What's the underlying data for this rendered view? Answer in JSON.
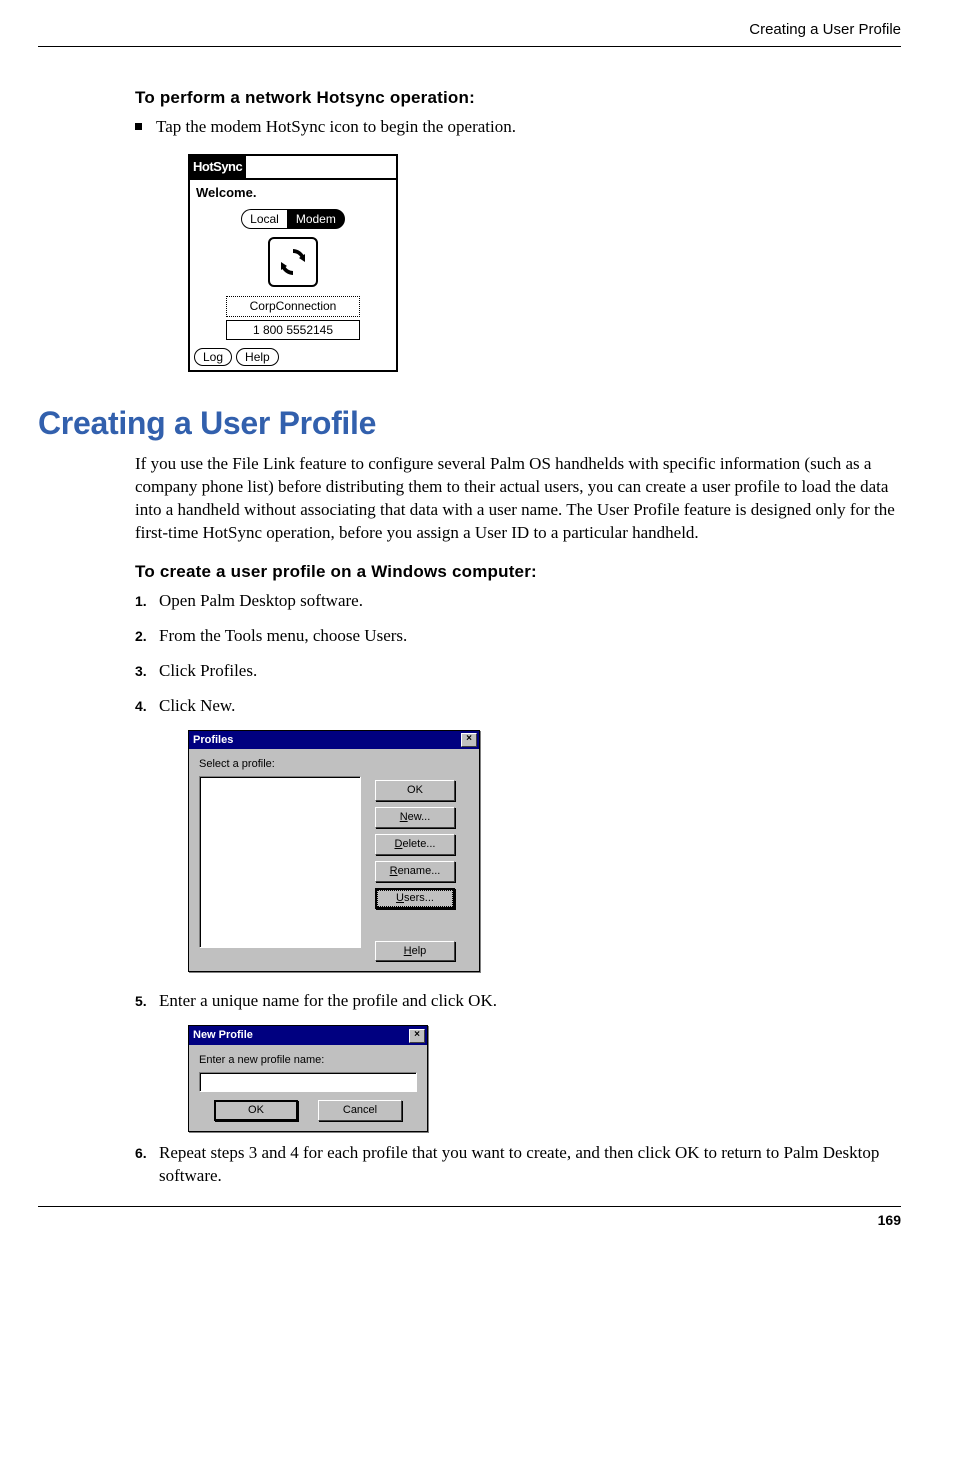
{
  "header": {
    "running": "Creating a User Profile"
  },
  "section1": {
    "subhead": "To perform a network Hotsync operation:",
    "bullet": "Tap the modem HotSync icon to begin the operation."
  },
  "hotsync": {
    "app": "HotSync",
    "welcome": "Welcome.",
    "tab_local": "Local",
    "tab_modem": "Modem",
    "conn": "CorpConnection",
    "phone": "1 800 5552145",
    "log": "Log",
    "help": "Help"
  },
  "section2": {
    "title": "Creating a User Profile",
    "body": "If you use the File Link feature to configure several Palm OS handhelds with specific information (such as a company phone list) before distributing them to their actual users, you can create a user profile to load the data into a handheld without associating that data with a user name. The User Profile feature is designed only for the first-time HotSync operation, before you assign a User ID to a particular handheld.",
    "subhead": "To create a user profile on a Windows computer:",
    "steps": {
      "s1": "Open Palm Desktop software.",
      "s2": "From the Tools menu, choose Users.",
      "s3": "Click Profiles.",
      "s4": "Click New.",
      "s5": "Enter a unique name for the profile and click OK.",
      "s6": "Repeat steps 3 and 4 for each profile that you want to create, and then click OK to return to Palm Desktop software."
    }
  },
  "profiles_dlg": {
    "title": "Profiles",
    "label": "Select a profile:",
    "ok": "OK",
    "new_pre": "N",
    "new_post": "ew...",
    "del_pre": "D",
    "del_post": "elete...",
    "ren_pre": "R",
    "ren_post": "ename...",
    "usr_pre": "U",
    "usr_post": "sers...",
    "hlp_pre": "H",
    "hlp_post": "elp"
  },
  "newprofile_dlg": {
    "title": "New Profile",
    "prompt": "Enter a new profile name:",
    "ok": "OK",
    "cancel": "Cancel"
  },
  "footer": {
    "page": "169"
  }
}
